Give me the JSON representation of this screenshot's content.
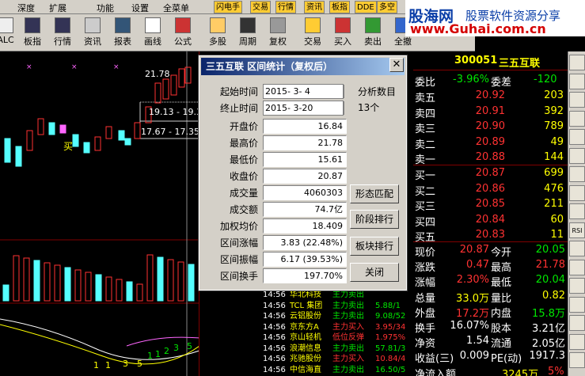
{
  "menubar": {
    "items": [
      "",
      "深度",
      "扩展",
      "功能",
      "设置",
      "全菜单"
    ],
    "quick": [
      "闪电手",
      "交易",
      "行情",
      "资讯",
      "板指",
      "DDE",
      "多空"
    ]
  },
  "watermark": {
    "brand": "股海网",
    "slogan": "股票软件资源分享",
    "url": "www.Guhai.com.cn"
  },
  "toolbar": {
    "items": [
      "ALC",
      "板指",
      "行情",
      "资讯",
      "报表",
      "画线",
      "公式",
      "多股",
      "周期",
      "复权",
      "交易",
      "买入",
      "卖出",
      "全撤"
    ]
  },
  "chart": {
    "high_label": "21.78",
    "mid_label": "19.13 - 19.3",
    "low_label": "17.67 - 17.35",
    "buy_label": "买",
    "wave_labels": [
      "1",
      "1",
      "3",
      "5",
      "1",
      "1",
      "2",
      "3",
      "5"
    ]
  },
  "quote": {
    "code": "300051",
    "name": "三五互联",
    "weibi_label": "委比",
    "weibi": "-3.96%",
    "weicha_label": "委差",
    "weicha": "-120",
    "sell": [
      {
        "label": "卖五",
        "price": "20.92",
        "vol": "203"
      },
      {
        "label": "卖四",
        "price": "20.91",
        "vol": "392"
      },
      {
        "label": "卖三",
        "price": "20.90",
        "vol": "789"
      },
      {
        "label": "卖二",
        "price": "20.89",
        "vol": "49"
      },
      {
        "label": "卖一",
        "price": "20.88",
        "vol": "144"
      }
    ],
    "buy": [
      {
        "label": "买一",
        "price": "20.87",
        "vol": "699"
      },
      {
        "label": "买二",
        "price": "20.86",
        "vol": "476"
      },
      {
        "label": "买三",
        "price": "20.85",
        "vol": "211"
      },
      {
        "label": "买四",
        "price": "20.84",
        "vol": "60"
      },
      {
        "label": "买五",
        "price": "20.83",
        "vol": "11"
      }
    ],
    "stats": [
      {
        "l1": "现价",
        "v1": "20.87",
        "c1": "red",
        "l2": "今开",
        "v2": "20.05",
        "c2": "green"
      },
      {
        "l1": "涨跌",
        "v1": "0.47",
        "c1": "red",
        "l2": "最高",
        "v2": "21.78",
        "c2": "red"
      },
      {
        "l1": "涨幅",
        "v1": "2.30%",
        "c1": "red",
        "l2": "最低",
        "v2": "20.04",
        "c2": "green"
      },
      {
        "l1": "总量",
        "v1": "33.0万",
        "c1": "yellow",
        "l2": "量比",
        "v2": "0.82",
        "c2": "yellow"
      },
      {
        "l1": "外盘",
        "v1": "17.2万",
        "c1": "red",
        "l2": "内盘",
        "v2": "15.8万",
        "c2": "green"
      },
      {
        "l1": "换手",
        "v1": "16.07%",
        "c1": "white",
        "l2": "股本",
        "v2": "3.21亿",
        "c2": "white"
      },
      {
        "l1": "净资",
        "v1": "1.54",
        "c1": "white",
        "l2": "流通",
        "v2": "2.05亿",
        "c2": "white"
      },
      {
        "l1": "收益(三)",
        "v1": "0.009",
        "c1": "white",
        "l2": "PE(动)",
        "v2": "1917.3",
        "c2": "white"
      }
    ],
    "inflow_label": "净流入额",
    "inflow": "3245万",
    "inflow_pct": "5%"
  },
  "ticker": {
    "rows": [
      {
        "time": "14:56",
        "name": "华北科技",
        "tag": "主力卖出",
        "val": "",
        "tag_color": "green"
      },
      {
        "time": "14:56",
        "name": "TCL 集团",
        "tag": "主力卖出",
        "val": "5.88/1",
        "tag_color": "green"
      },
      {
        "time": "14:56",
        "name": "云铝股份",
        "tag": "主力卖出",
        "val": "9.08/52",
        "tag_color": "green"
      },
      {
        "time": "14:56",
        "name": "京东方A",
        "tag": "主力买入",
        "val": "3.95/34",
        "tag_color": "red"
      },
      {
        "time": "14:56",
        "name": "京山轻机",
        "tag": "低位反弹",
        "val": "1.975%",
        "tag_color": "red"
      },
      {
        "time": "14:56",
        "name": "浪潮信息",
        "tag": "主力卖出",
        "val": "57.81/3",
        "tag_color": "green"
      },
      {
        "time": "14:56",
        "name": "兆驰股份",
        "tag": "主力买入",
        "val": "10.84/4",
        "tag_color": "red"
      },
      {
        "time": "14:56",
        "name": "中信海直",
        "tag": "主力卖出",
        "val": "16.50/5",
        "tag_color": "green"
      }
    ]
  },
  "dialog": {
    "title": "三五互联  区间统计（复权后）",
    "start_label": "起始时间",
    "start": "2015- 3- 4",
    "end_label": "终止时间",
    "end": "2015- 3-20",
    "periods_label": "分析数目",
    "periods": "13个",
    "fields": [
      {
        "label": "开盘价",
        "value": "16.84"
      },
      {
        "label": "最高价",
        "value": "21.78"
      },
      {
        "label": "最低价",
        "value": "15.61"
      },
      {
        "label": "收盘价",
        "value": "20.87"
      },
      {
        "label": "成交量",
        "value": "4060303"
      },
      {
        "label": "成交额",
        "value": "74.7亿"
      },
      {
        "label": "加权均价",
        "value": "18.409"
      },
      {
        "label": "区间涨幅",
        "value": "3.83 (22.48%)"
      },
      {
        "label": "区间振幅",
        "value": "6.17 (39.53%)"
      },
      {
        "label": "区间换手",
        "value": "197.70%"
      }
    ],
    "btn_pattern": "形态匹配",
    "btn_stage": "阶段排行",
    "btn_sector": "板块排行",
    "btn_close": "关闭"
  },
  "sidebar": {
    "labels": [
      "",
      "",
      "",
      "",
      "",
      "",
      "",
      "",
      "",
      "RSI",
      "",
      "",
      "",
      "",
      "",
      "",
      ""
    ]
  },
  "colors": {
    "up": "#ff3232",
    "down": "#00e600",
    "accent": "#ffff00"
  }
}
